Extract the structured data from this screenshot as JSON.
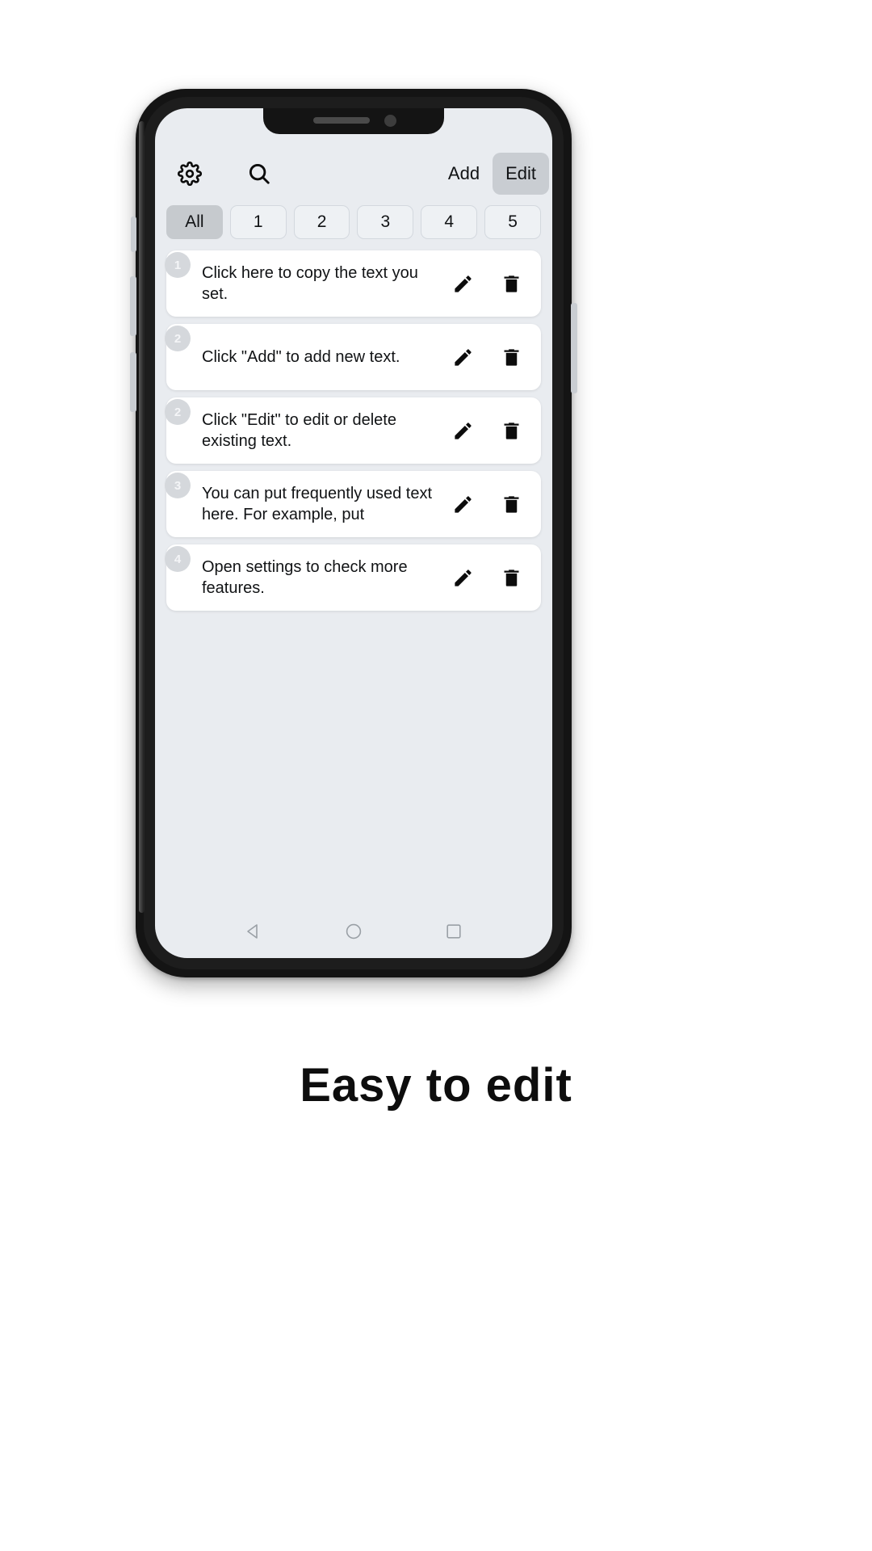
{
  "caption": "Easy to edit",
  "toolbar": {
    "settings_icon": "gear-icon",
    "search_icon": "search-icon",
    "add_label": "Add",
    "edit_label": "Edit",
    "edit_active": true,
    "active_bg": "#c9cdd2"
  },
  "tabs": {
    "items": [
      {
        "label": "All",
        "selected": true
      },
      {
        "label": "1",
        "selected": false
      },
      {
        "label": "2",
        "selected": false
      },
      {
        "label": "3",
        "selected": false
      },
      {
        "label": "4",
        "selected": false
      },
      {
        "label": "5",
        "selected": false
      }
    ]
  },
  "list": {
    "items": [
      {
        "badge": "1",
        "text": "Click here to copy the text you set.",
        "edit_icon": "pencil-icon",
        "delete_icon": "trash-icon"
      },
      {
        "badge": "2",
        "text": "Click \"Add\" to add new text.",
        "edit_icon": "pencil-icon",
        "delete_icon": "trash-icon"
      },
      {
        "badge": "2",
        "text": "Click \"Edit\" to edit or delete existing text.",
        "edit_icon": "pencil-icon",
        "delete_icon": "trash-icon"
      },
      {
        "badge": "3",
        "text": "You can put frequently used text here. For example, put",
        "edit_icon": "pencil-icon",
        "delete_icon": "trash-icon"
      },
      {
        "badge": "4",
        "text": "Open settings to check more features.",
        "edit_icon": "pencil-icon",
        "delete_icon": "trash-icon"
      }
    ]
  },
  "navbar": {
    "back_icon": "back-triangle-icon",
    "home_icon": "home-circle-icon",
    "recents_icon": "recents-square-icon"
  },
  "colors": {
    "screen_bg": "#e9ecf0",
    "card_bg": "#ffffff",
    "badge_bg": "#d5d8dc",
    "text": "#111315",
    "device": "#141414"
  }
}
